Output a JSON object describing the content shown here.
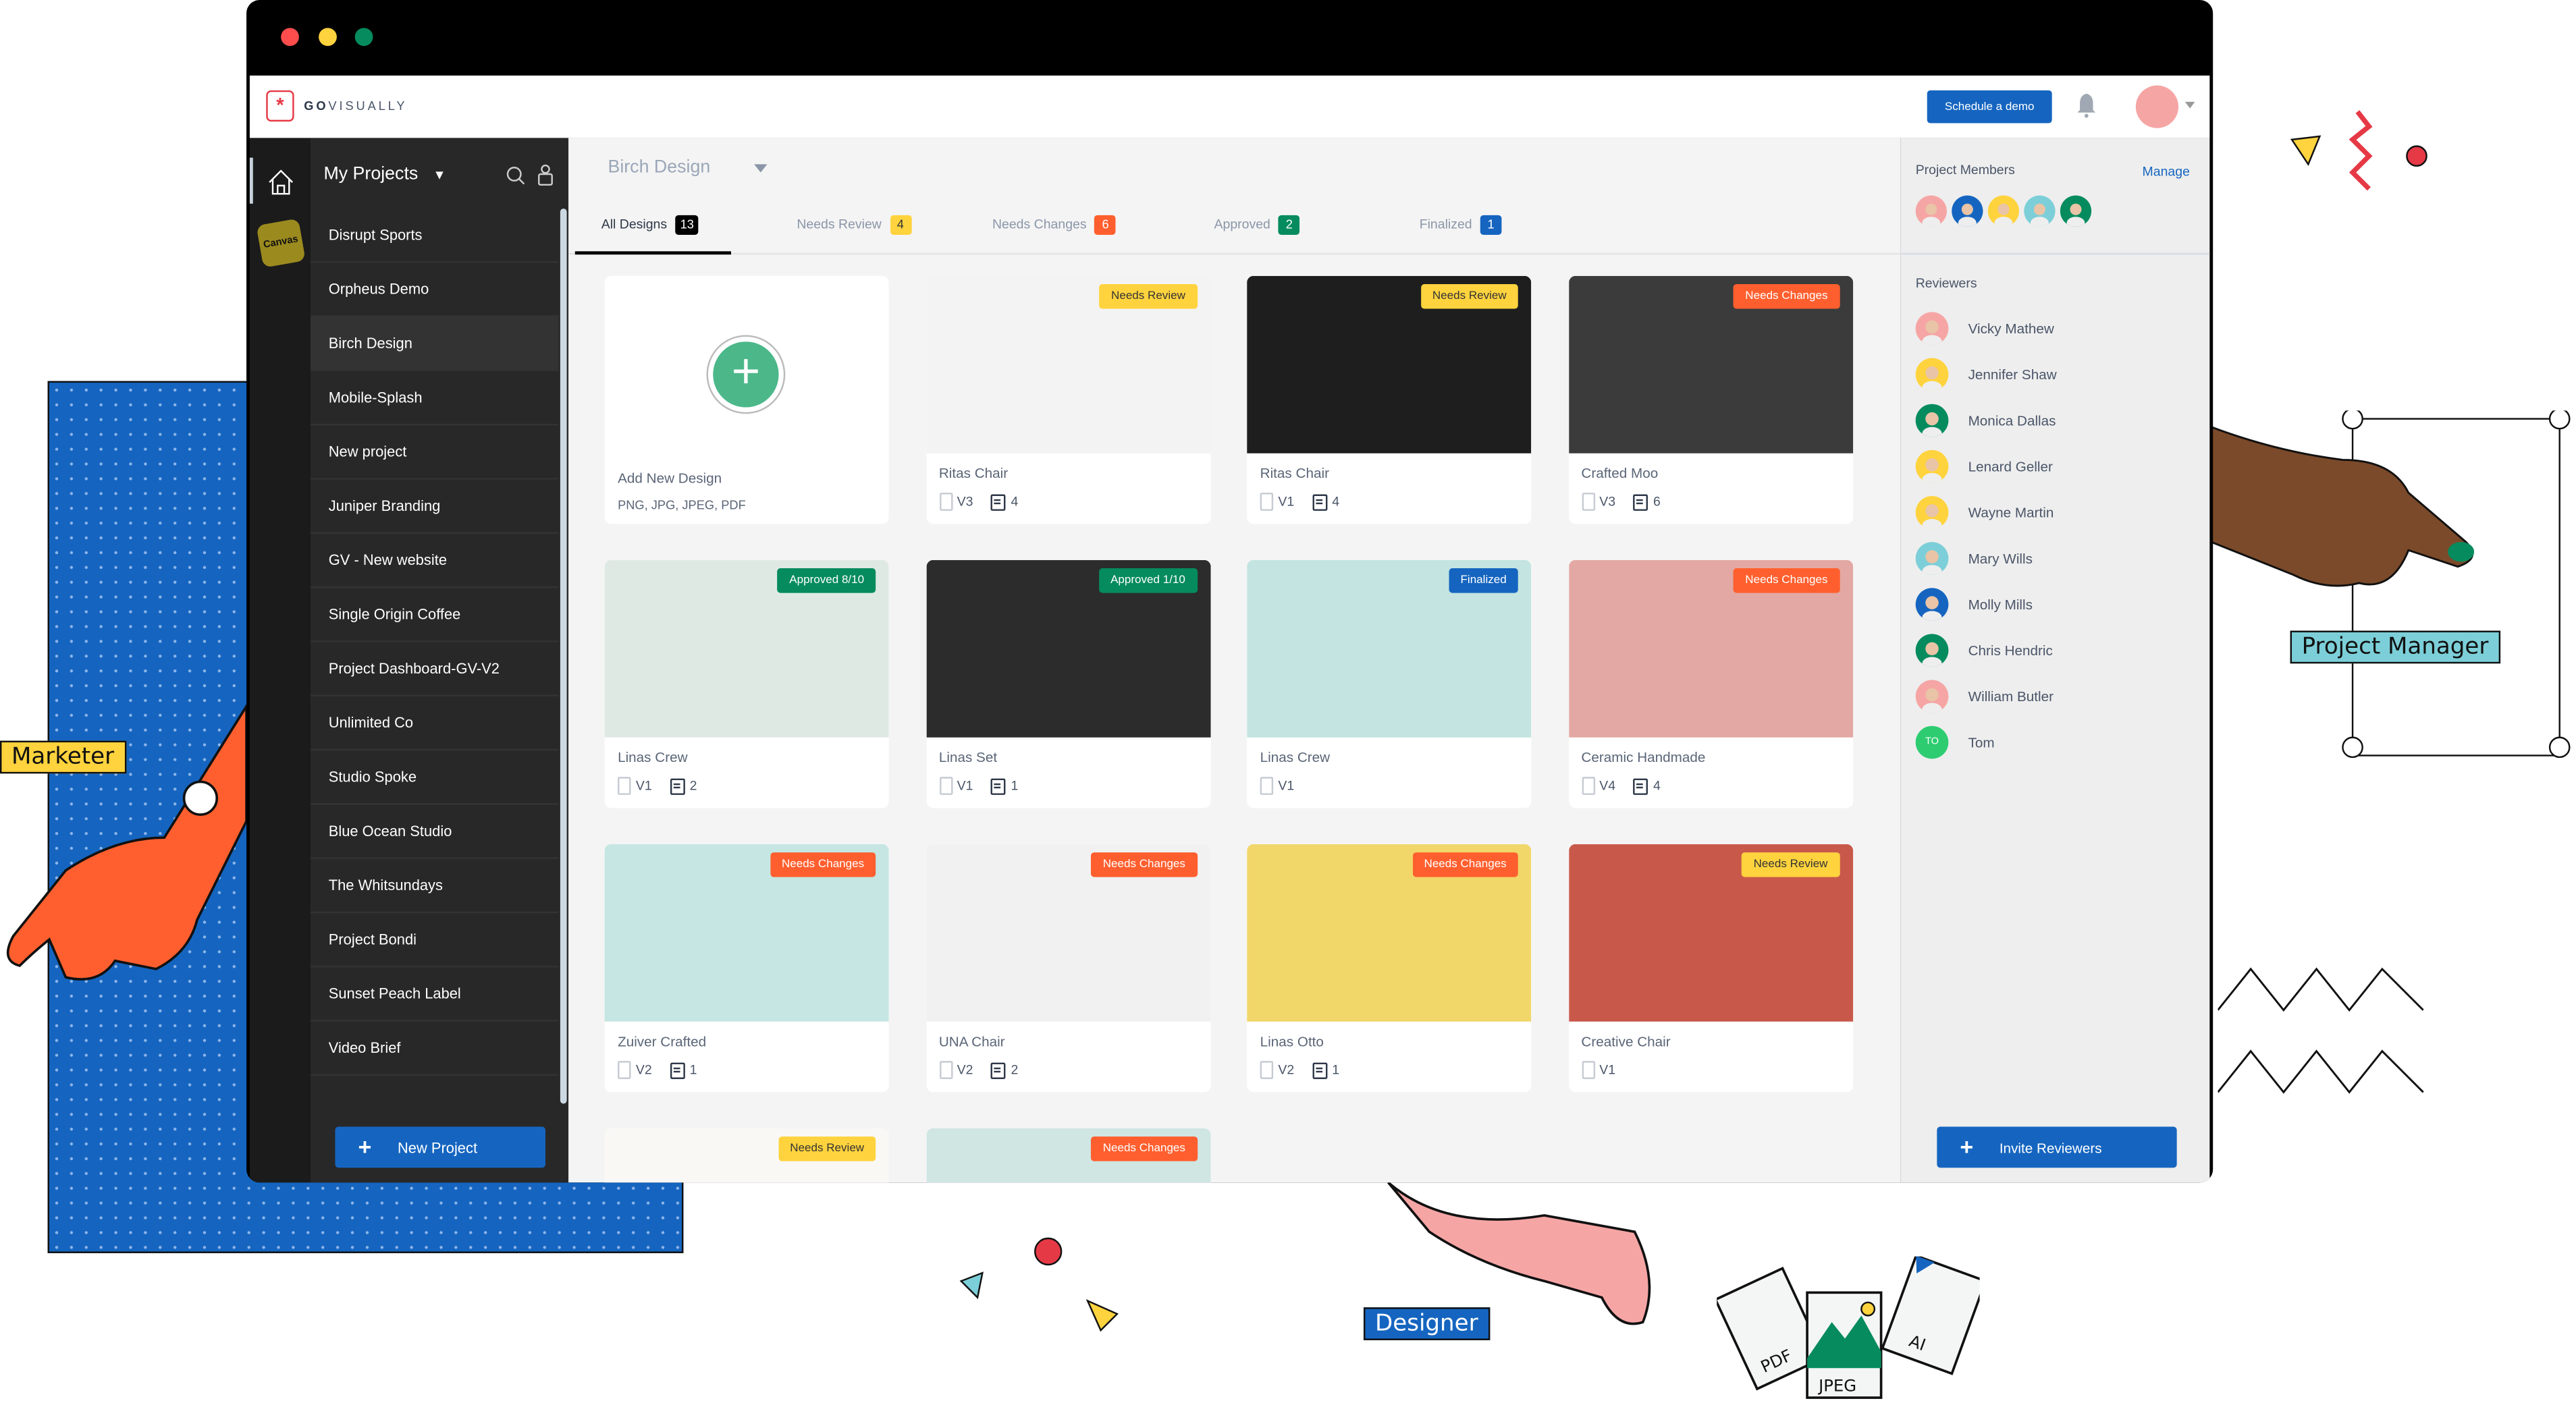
{
  "app": {
    "brand_bold": "GO",
    "brand_rest": "VISUALLY"
  },
  "header": {
    "schedule_demo": "Schedule a demo"
  },
  "rail": {
    "canvas_label": "Canvas"
  },
  "sidebar": {
    "title": "My Projects",
    "items": [
      {
        "label": "Disrupt Sports"
      },
      {
        "label": "Orpheus Demo"
      },
      {
        "label": "Birch Design",
        "active": true
      },
      {
        "label": "Mobile-Splash"
      },
      {
        "label": "New project"
      },
      {
        "label": "Juniper Branding"
      },
      {
        "label": "GV - New website"
      },
      {
        "label": "Single Origin Coffee"
      },
      {
        "label": "Project Dashboard-GV-V2"
      },
      {
        "label": "Unlimited Co"
      },
      {
        "label": "Studio Spoke"
      },
      {
        "label": "Blue Ocean Studio"
      },
      {
        "label": "The Whitsundays"
      },
      {
        "label": "Project Bondi"
      },
      {
        "label": "Sunset Peach Label"
      },
      {
        "label": "Video Brief"
      }
    ],
    "new_project": "New Project"
  },
  "main": {
    "project_title": "Birch Design",
    "tabs": [
      {
        "label": "All Designs",
        "count": "13",
        "color": "#000000"
      },
      {
        "label": "Needs Review",
        "count": "4",
        "color": "#ffd33d"
      },
      {
        "label": "Needs Changes",
        "count": "6",
        "color": "#ff5f2e"
      },
      {
        "label": "Approved",
        "count": "2",
        "color": "#058b5e"
      },
      {
        "label": "Finalized",
        "count": "1",
        "color": "#1565c0"
      }
    ],
    "add_card": {
      "title": "Add New Design",
      "formats": "PNG, JPG, JPEG, PDF"
    },
    "designs": [
      {
        "name": "Ritas Chair",
        "status": "Needs Review",
        "version": "V3",
        "comments": "4"
      },
      {
        "name": "Ritas Chair",
        "status": "Needs Review",
        "version": "V1",
        "comments": "4"
      },
      {
        "name": "Crafted Moo",
        "status": "Needs Changes",
        "version": "V3",
        "comments": "6"
      },
      {
        "name": "Linas Crew",
        "status": "Approved 8/10",
        "version": "V1",
        "comments": "2"
      },
      {
        "name": "Linas Set",
        "status": "Approved 1/10",
        "version": "V1",
        "comments": "1"
      },
      {
        "name": "Linas Crew",
        "status": "Finalized",
        "version": "V1",
        "comments": null
      },
      {
        "name": "Ceramic Handmade",
        "status": "Needs Changes",
        "version": "V4",
        "comments": "4"
      },
      {
        "name": "Zuiver Crafted",
        "status": "Needs Changes",
        "version": "V2",
        "comments": "1"
      },
      {
        "name": "UNA Chair",
        "status": "Needs Changes",
        "version": "V2",
        "comments": "2"
      },
      {
        "name": "Linas Otto",
        "status": "Needs Changes",
        "version": "V2",
        "comments": "1"
      },
      {
        "name": "Creative Chair",
        "status": "Needs Review",
        "version": "V1",
        "comments": null
      },
      {
        "name": "",
        "status": "Needs Review",
        "version": "",
        "comments": null
      },
      {
        "name": "",
        "status": "Needs Changes",
        "version": "",
        "comments": null
      }
    ],
    "status_colors": {
      "Needs Review": "#ffd33d",
      "Needs Changes": "#ff5f2e",
      "Approved": "#058b5e",
      "Finalized": "#1565c0"
    }
  },
  "right_panel": {
    "members_title": "Project Members",
    "manage": "Manage",
    "members": [
      "#f6a5a5",
      "#1565c0",
      "#ffd33d",
      "#7ccfd8",
      "#058b5e"
    ],
    "reviewers_title": "Reviewers",
    "reviewers": [
      {
        "name": "Vicky Mathew",
        "color": "#f6a5a5"
      },
      {
        "name": "Jennifer Shaw",
        "color": "#ffd33d"
      },
      {
        "name": "Monica Dallas",
        "color": "#058b5e"
      },
      {
        "name": "Lenard Geller",
        "color": "#ffd33d"
      },
      {
        "name": "Wayne Martin",
        "color": "#ffd33d"
      },
      {
        "name": "Mary Wills",
        "color": "#7ccfd8"
      },
      {
        "name": "Molly Mills",
        "color": "#1565c0"
      },
      {
        "name": "Chris Hendric",
        "color": "#058b5e"
      },
      {
        "name": "William Butler",
        "color": "#f6a5a5"
      },
      {
        "name": "Tom",
        "color": "#2ecc71",
        "initials": "TO"
      }
    ],
    "invite": "Invite Reviewers"
  },
  "decorations": {
    "marketer": "Marketer",
    "project_manager": "Project Manager",
    "designer": "Designer",
    "files": [
      "PDF",
      "JPEG",
      "AI"
    ]
  }
}
